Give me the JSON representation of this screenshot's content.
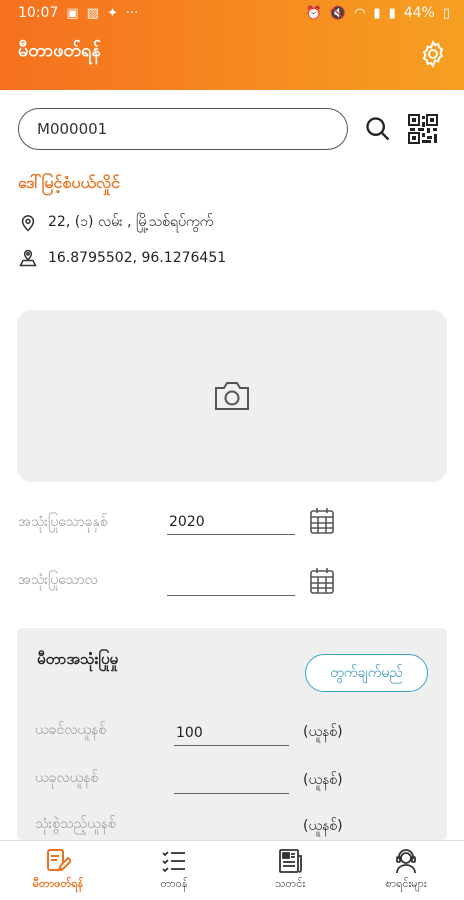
{
  "status_bar": {
    "time": "10:07",
    "battery": "44%"
  },
  "header": {
    "title": "မီတာဖတ်ရန်"
  },
  "search": {
    "value": "M000001"
  },
  "customer": {
    "name": "ဒေါ်မြင့်စံပယ်လှိုင်",
    "address": "22, (၁) လမ်း , မြို့သစ်ရပ်ကွက်",
    "coordinates": "16.8795502, 96.1276451"
  },
  "form": {
    "year_label": "အသုံးပြုသောခုနှစ်",
    "year_value": "2020",
    "month_label": "အသုံးပြုသောလ",
    "month_value": ""
  },
  "usage": {
    "title": "မီတာအသုံးပြုမှု",
    "calc_label": "တွက်ချက်မည်",
    "previous_label": "ယခင်လယူနစ်",
    "previous_value": "100",
    "current_label": "ယခုလယူနစ်",
    "current_value": "",
    "used_label": "သုံးစွဲသည့်ယူနစ်",
    "used_value": "",
    "unit": "(ယူနစ်)"
  },
  "bottom_nav": {
    "items": [
      {
        "label": "မီတာဖတ်ရန်",
        "icon": "edit-document-icon",
        "active": true
      },
      {
        "label": "တာဝန်",
        "icon": "task-list-icon",
        "active": false
      },
      {
        "label": "သတင်း",
        "icon": "news-icon",
        "active": false
      },
      {
        "label": "စာရင်းများ",
        "icon": "support-agent-icon",
        "active": false
      }
    ]
  },
  "colors": {
    "header_start": "#f5701f",
    "header_end": "#f6a021",
    "accent": "#e87422",
    "calc_button": "#3aa6c4"
  }
}
